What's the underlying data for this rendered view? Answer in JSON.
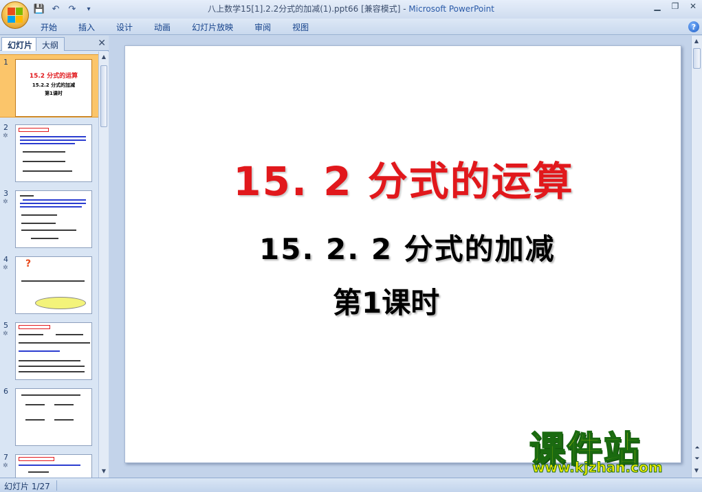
{
  "window": {
    "title": "八上数学15[1].2.2分式的加减(1).ppt66 [兼容模式]",
    "separator": " - ",
    "app_name": "Microsoft PowerPoint"
  },
  "qat": {
    "save": "💾",
    "undo": "↶",
    "redo": "↷",
    "more": "▾"
  },
  "ribbon": {
    "tabs": [
      "开始",
      "插入",
      "设计",
      "动画",
      "幻灯片放映",
      "审阅",
      "视图"
    ],
    "help": "?"
  },
  "left_pane": {
    "tab_slides": "幻灯片",
    "tab_outline": "大纲",
    "close": "✕",
    "thumbnails": [
      {
        "number": "1",
        "anim": "",
        "title": "15.2 分式的运算",
        "line2": "15.2.2 分式的加减",
        "line3": "第1课时"
      },
      {
        "number": "2",
        "anim": "✲"
      },
      {
        "number": "3",
        "anim": "✲"
      },
      {
        "number": "4",
        "anim": "✲"
      },
      {
        "number": "5",
        "anim": "✲"
      },
      {
        "number": "6",
        "anim": ""
      },
      {
        "number": "7",
        "anim": "✲"
      }
    ]
  },
  "slide": {
    "title": "15. 2  分式的运算",
    "subtitle": "15. 2. 2  分式的加减",
    "subtitle2": "第1课时"
  },
  "watermark": {
    "text": "课件站",
    "url": "www.kjzhan.com"
  },
  "status": {
    "slide_counter": "幻灯片 1/27"
  },
  "colors": {
    "title_red": "#e1181c",
    "selected_thumb": "#fbc56a",
    "watermark_yellow": "#f0ec00"
  }
}
